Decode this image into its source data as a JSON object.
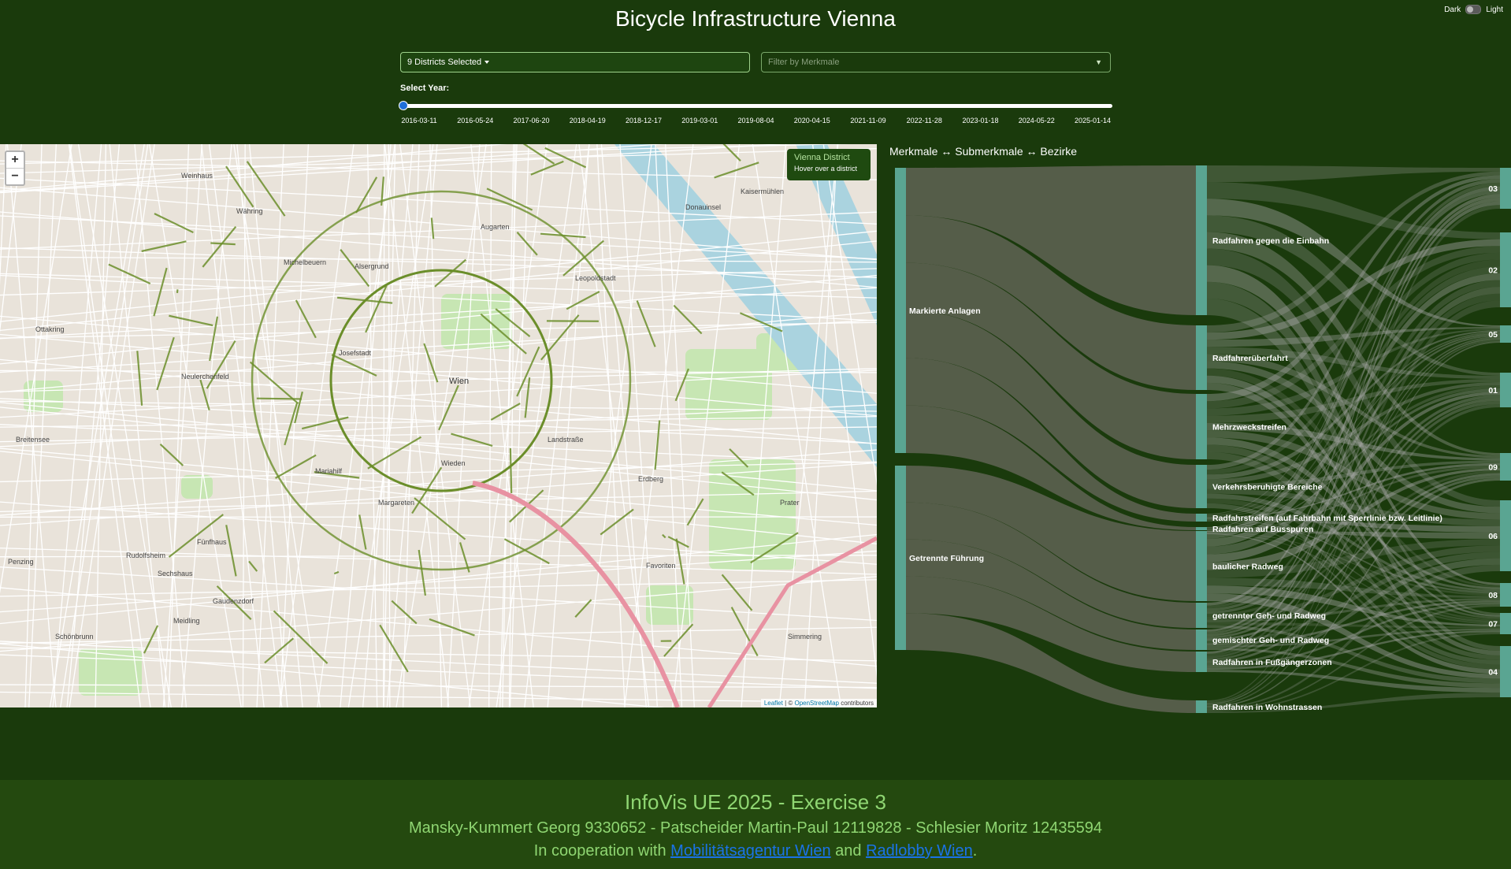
{
  "header": {
    "title": "Bicycle Infrastructure Vienna"
  },
  "theme": {
    "dark_label": "Dark",
    "light_label": "Light"
  },
  "filters": {
    "district_dropdown_value": "9 Districts Selected",
    "merkmal_placeholder": "Filter by Merkmale"
  },
  "year_slider": {
    "label": "Select Year:",
    "selected_index": 0,
    "ticks": [
      "2016-03-11",
      "2016-05-24",
      "2017-06-20",
      "2018-04-19",
      "2018-12-17",
      "2019-03-01",
      "2019-08-04",
      "2020-04-15",
      "2021-11-09",
      "2022-11-28",
      "2023-01-18",
      "2024-05-22",
      "2025-01-14"
    ]
  },
  "map": {
    "zoom_in": "+",
    "zoom_out": "−",
    "info_title": "Vienna District",
    "info_hint": "Hover over a district",
    "attribution_leaflet": "Leaflet",
    "attribution_sep": " | © ",
    "attribution_osm": "OpenStreetMap",
    "attribution_tail": " contributors",
    "place_labels": [
      "Weinhaus",
      "Währing",
      "Michelbeuern",
      "Ottakring",
      "Neulerchenfeld",
      "Breitensee",
      "Penzing",
      "Rudolfsheim",
      "Fünfhaus",
      "Sechshaus",
      "Meidling",
      "Wien",
      "Landstraße",
      "Leopoldstadt",
      "Prater",
      "Favoriten",
      "Margareten",
      "Wieden",
      "Mariahilf",
      "Josefstadt",
      "Alsergrund",
      "Augarten",
      "Kaisermühlen",
      "Donauinsel",
      "Schönbrunn",
      "Gaudenzdorf",
      "Erdberg",
      "Simmering"
    ]
  },
  "sankey": {
    "title": "Merkmale ↔ Submerkmale ↔ Bezirke",
    "colors": {
      "node": "#5aa592",
      "link_main": "#595f4d",
      "link_light": "#aaaaaa"
    },
    "merkmale": [
      {
        "name": "Markierte Anlagen"
      },
      {
        "name": "Getrennte Führung"
      }
    ],
    "submerkmale": [
      {
        "name": "Radfahren gegen die Einbahn"
      },
      {
        "name": "Radfahrerüberfahrt"
      },
      {
        "name": "Mehrzweckstreifen"
      },
      {
        "name": "Verkehrsberuhigte Bereiche"
      },
      {
        "name": "Radfahrstreifen (auf Fahrbahn mit Sperrlinie bzw. Leitlinie)"
      },
      {
        "name": "Radfahren auf Busspuren"
      },
      {
        "name": "baulicher Radweg"
      },
      {
        "name": "getrennter Geh- und Radweg"
      },
      {
        "name": "gemischter Geh- und Radweg"
      },
      {
        "name": "Radfahren in Fußgängerzonen"
      },
      {
        "name": "Radfahren in Wohnstrassen"
      }
    ],
    "bezirke": [
      {
        "name": "03"
      },
      {
        "name": "02"
      },
      {
        "name": "05"
      },
      {
        "name": "01"
      },
      {
        "name": "09"
      },
      {
        "name": "06"
      },
      {
        "name": "08"
      },
      {
        "name": "07"
      },
      {
        "name": "04"
      }
    ]
  },
  "footer": {
    "title": "InfoVis UE 2025 - Exercise 3",
    "authors": "Mansky-Kummert Georg 9330652 - Patscheider Martin-Paul 12119828 - Schlesier Moritz 12435594",
    "coop_prefix": "In cooperation with ",
    "coop_link1": "Mobilitätsagentur Wien",
    "coop_mid": " and ",
    "coop_link2": "Radlobby Wien",
    "coop_suffix": "."
  }
}
